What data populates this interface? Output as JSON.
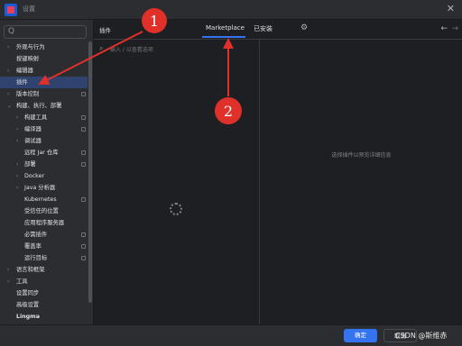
{
  "window": {
    "title": "设置",
    "close_symbol": "✕"
  },
  "sidebar": {
    "search_placeholder": "",
    "search_icon_glyph": "Q",
    "items": [
      {
        "label": "外观与行为",
        "expandable": true
      },
      {
        "label": "按键映射",
        "expandable": false
      },
      {
        "label": "编辑器",
        "expandable": true
      },
      {
        "label": "插件",
        "expandable": false,
        "selected": true
      },
      {
        "label": "版本控制",
        "expandable": true,
        "pin": true
      },
      {
        "label": "构建、执行、部署",
        "expandable": true,
        "expanded": true
      },
      {
        "label": "构建工具",
        "expandable": true,
        "pin": true
      },
      {
        "label": "编译器",
        "expandable": true,
        "pin": true
      },
      {
        "label": "调试器",
        "expandable": true
      },
      {
        "label": "远程 Jar 仓库",
        "expandable": false,
        "pin": true
      },
      {
        "label": "部署",
        "expandable": true,
        "pin": true
      },
      {
        "label": "Docker",
        "expandable": true
      },
      {
        "label": "Java 分析器",
        "expandable": true
      },
      {
        "label": "Kubernetes",
        "expandable": false,
        "pin": true
      },
      {
        "label": "受信任的位置",
        "expandable": false
      },
      {
        "label": "应用程序服务器",
        "expandable": false
      },
      {
        "label": "必需插件",
        "expandable": false,
        "pin": true
      },
      {
        "label": "覆盖率",
        "expandable": false,
        "pin": true
      },
      {
        "label": "运行目标",
        "expandable": false,
        "pin": true
      },
      {
        "label": "语言和框架",
        "expandable": true
      },
      {
        "label": "工具",
        "expandable": true
      },
      {
        "label": "设置同步",
        "expandable": false
      },
      {
        "label": "高级设置",
        "expandable": false
      },
      {
        "label": "Lingma",
        "expandable": false,
        "bold": true
      }
    ],
    "help_label": "?"
  },
  "main": {
    "breadcrumb": "插件",
    "tabs": [
      {
        "label": "Marketplace",
        "active": true
      },
      {
        "label": "已安装",
        "active": false
      }
    ],
    "plugin_search_placeholder": "输入 / 以查看选项",
    "details_empty": "选择插件以预览详细信息"
  },
  "footer": {
    "ok_label": "确定",
    "cancel_label": "取消",
    "watermark": "CSDN @斯维赤"
  },
  "annotations": [
    {
      "number": "1"
    },
    {
      "number": "2"
    }
  ],
  "colors": {
    "accent": "#3574f0",
    "selection": "#2e436e",
    "annotation": "#e0302a",
    "background": "#1e1f22"
  }
}
